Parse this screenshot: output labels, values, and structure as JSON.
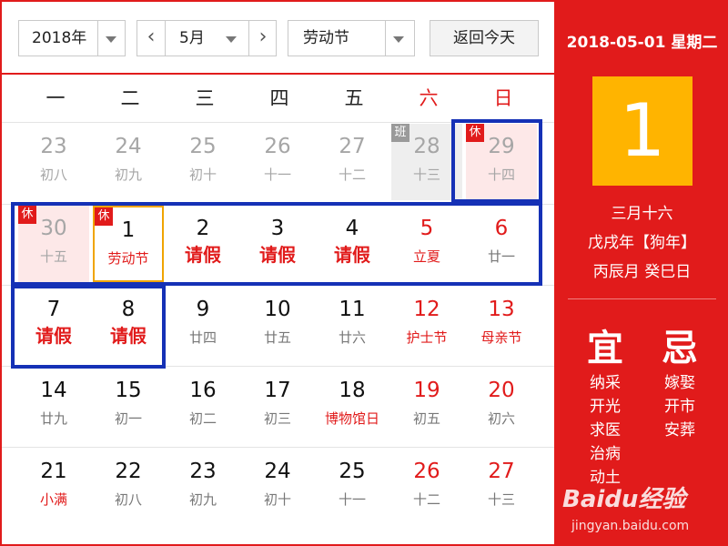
{
  "toolbar": {
    "year": "2018年",
    "month": "5月",
    "holiday": "劳动节",
    "today_label": "返回今天",
    "prev_icon": "chevron-left-icon",
    "next_icon": "chevron-right-icon"
  },
  "weekdays": [
    "一",
    "二",
    "三",
    "四",
    "五",
    "六",
    "日"
  ],
  "weeks": [
    [
      {
        "day": "23",
        "sub": "初八",
        "other": true
      },
      {
        "day": "24",
        "sub": "初九",
        "other": true
      },
      {
        "day": "25",
        "sub": "初十",
        "other": true
      },
      {
        "day": "26",
        "sub": "十一",
        "other": true
      },
      {
        "day": "27",
        "sub": "十二",
        "other": true
      },
      {
        "day": "28",
        "sub": "十三",
        "other": true,
        "badge": "班",
        "work": true
      },
      {
        "day": "29",
        "sub": "十四",
        "other": true,
        "badge": "休",
        "rest": true
      }
    ],
    [
      {
        "day": "30",
        "sub": "十五",
        "other": true,
        "badge": "休",
        "rest": true
      },
      {
        "day": "1",
        "sub": "劳动节",
        "badge": "休",
        "rest": true,
        "selected": true,
        "festival": true
      },
      {
        "day": "2",
        "sub": "请假",
        "leave": true
      },
      {
        "day": "3",
        "sub": "请假",
        "leave": true
      },
      {
        "day": "4",
        "sub": "请假",
        "leave": true
      },
      {
        "day": "5",
        "sub": "立夏",
        "weekend": true,
        "festival": true
      },
      {
        "day": "6",
        "sub": "廿一",
        "weekend": true
      }
    ],
    [
      {
        "day": "7",
        "sub": "请假",
        "leave": true
      },
      {
        "day": "8",
        "sub": "请假",
        "leave": true
      },
      {
        "day": "9",
        "sub": "廿四"
      },
      {
        "day": "10",
        "sub": "廿五"
      },
      {
        "day": "11",
        "sub": "廿六"
      },
      {
        "day": "12",
        "sub": "护士节",
        "weekend": true,
        "festival": true
      },
      {
        "day": "13",
        "sub": "母亲节",
        "weekend": true,
        "festival": true
      }
    ],
    [
      {
        "day": "14",
        "sub": "廿九"
      },
      {
        "day": "15",
        "sub": "初一"
      },
      {
        "day": "16",
        "sub": "初二"
      },
      {
        "day": "17",
        "sub": "初三"
      },
      {
        "day": "18",
        "sub": "博物馆日",
        "festival": true
      },
      {
        "day": "19",
        "sub": "初五",
        "weekend": true
      },
      {
        "day": "20",
        "sub": "初六",
        "weekend": true
      }
    ],
    [
      {
        "day": "21",
        "sub": "小满",
        "festival": true
      },
      {
        "day": "22",
        "sub": "初八"
      },
      {
        "day": "23",
        "sub": "初九"
      },
      {
        "day": "24",
        "sub": "初十"
      },
      {
        "day": "25",
        "sub": "十一"
      },
      {
        "day": "26",
        "sub": "十二",
        "weekend": true
      },
      {
        "day": "27",
        "sub": "十三",
        "weekend": true
      }
    ]
  ],
  "panel": {
    "date_line": "2018-05-01 星期二",
    "big_day": "1",
    "lunar": "三月十六",
    "year_ganzhi": "戊戌年【狗年】",
    "month_day_ganzhi": "丙辰月 癸巳日",
    "yi_title": "宜",
    "ji_title": "忌",
    "yi": [
      "纳采",
      "开光",
      "求医",
      "治病",
      "动土"
    ],
    "ji": [
      "嫁娶",
      "开市",
      "安葬"
    ]
  },
  "watermark": {
    "logo": "Baidu经验",
    "url": "jingyan.baidu.com"
  },
  "colors": {
    "accent_red": "#e11b1b",
    "today_yellow": "#ffb400",
    "highlight_blue": "#1531b6"
  }
}
